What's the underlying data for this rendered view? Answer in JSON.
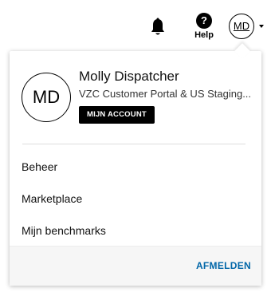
{
  "header": {
    "bell_icon": "bell-icon",
    "help_icon_glyph": "?",
    "help_label": "Help",
    "avatar_initials": "MD",
    "caret_icon": "caret-down-icon"
  },
  "profile": {
    "initials": "MD",
    "name": "Molly Dispatcher",
    "organization": "VZC Customer Portal & US Staging...",
    "account_button": "MIJN ACCOUNT"
  },
  "menu": {
    "items": [
      {
        "label": "Beheer"
      },
      {
        "label": "Marketplace"
      },
      {
        "label": "Mijn benchmarks"
      }
    ]
  },
  "footer": {
    "logout_label": "AFMELDEN"
  },
  "colors": {
    "link_blue": "#0066a8",
    "button_black": "#000000",
    "footer_bg": "#f6f6f6"
  }
}
